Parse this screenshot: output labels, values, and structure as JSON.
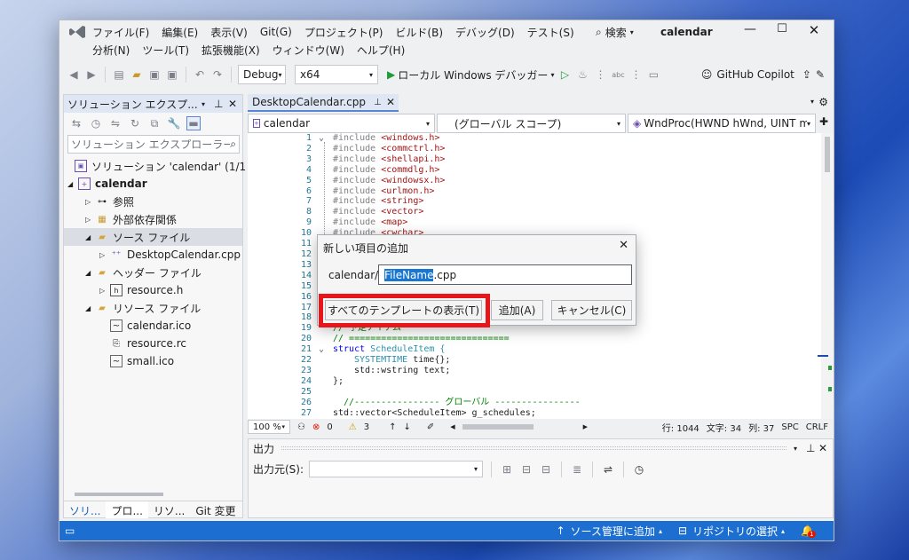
{
  "titlebar": {
    "menu_row1": [
      "ファイル(F)",
      "編集(E)",
      "表示(V)",
      "Git(G)",
      "プロジェクト(P)",
      "ビルド(B)",
      "デバッグ(D)",
      "テスト(S)"
    ],
    "search": "検索",
    "title": "calendar",
    "menu_row2": [
      "分析(N)",
      "ツール(T)",
      "拡張機能(X)",
      "ウィンドウ(W)",
      "ヘルプ(H)"
    ]
  },
  "toolbar": {
    "config": "Debug",
    "platform": "x64",
    "run_label": "ローカル Windows デバッガー",
    "copilot": "GitHub Copilot"
  },
  "solution_explorer": {
    "title": "ソリューション エクスプ...",
    "search_placeholder": "ソリューション エクスプローラー",
    "items": [
      {
        "label": "ソリューション 'calendar' (1/1 の",
        "icon": "solution-icon"
      },
      {
        "label": "calendar",
        "icon": "project-icon"
      },
      {
        "label": "参照",
        "icon": "references-icon"
      },
      {
        "label": "外部依存関係",
        "icon": "external-deps-icon"
      },
      {
        "label": "ソース ファイル",
        "icon": "folder-icon"
      },
      {
        "label": "DesktopCalendar.cpp",
        "icon": "cpp-file-icon"
      },
      {
        "label": "ヘッダー ファイル",
        "icon": "folder-icon"
      },
      {
        "label": "resource.h",
        "icon": "header-file-icon"
      },
      {
        "label": "リソース ファイル",
        "icon": "folder-icon"
      },
      {
        "label": "calendar.ico",
        "icon": "image-file-icon"
      },
      {
        "label": "resource.rc",
        "icon": "rc-file-icon"
      },
      {
        "label": "small.ico",
        "icon": "image-file-icon"
      }
    ],
    "bottom_tabs": [
      "ソリ...",
      "プロ...",
      "リソ...",
      "Git 変更"
    ]
  },
  "editor": {
    "tab": "DesktopCalendar.cpp",
    "nav_project": "calendar",
    "nav_scope": "(グローバル スコープ)",
    "nav_member": "WndProc(HWND hWnd, UINT ms",
    "line_numbers": [
      "1",
      "2",
      "3",
      "4",
      "5",
      "6",
      "7",
      "8",
      "9",
      "10",
      "11",
      "12",
      "13",
      "14",
      "15",
      "16",
      "17",
      "18",
      "19",
      "20",
      "21",
      "22",
      "23",
      "24",
      "25",
      "26",
      "27"
    ],
    "includes": [
      "<windows.h>",
      "<commctrl.h>",
      "<shellapi.h>",
      "<commdlg.h>",
      "<windowsx.h>",
      "<urlmon.h>",
      "<string>",
      "<vector>",
      "<map>",
      "<cwchar>"
    ],
    "include_kw": "#include",
    "line19": "// 予定アイテム",
    "line20": "// ==============================",
    "line21_kw": "struct",
    "line21_name": "ScheduleItem {",
    "line22_type": "SYSTEMTIME",
    "line22_rest": " time{};",
    "line23": "std::wstring text;",
    "line24": "};",
    "line26": "//---------------- グローバル ----------------",
    "line27": "std::vector<ScheduleItem> g_schedules;"
  },
  "editor_status": {
    "zoom": "100 %",
    "errors": "0",
    "warnings": "3",
    "line": "行: 1044",
    "char": "文字: 34",
    "col": "列: 37",
    "spc": "SPC",
    "crlf": "CRLF"
  },
  "output": {
    "title": "出力",
    "source_label": "出力元(S):"
  },
  "dialog": {
    "title": "新しい項目の追加",
    "prefix": "calendar/",
    "input_selected": "FileName",
    "input_rest": ".cpp",
    "show_templates": "すべてのテンプレートの表示(T)",
    "add": "追加(A)",
    "cancel": "キャンセル(C)",
    "highlight_color": "#e8151b"
  },
  "statusbar": {
    "source_control": "ソース管理に追加",
    "repo": "リポジトリの選択",
    "notif_count": "1"
  }
}
